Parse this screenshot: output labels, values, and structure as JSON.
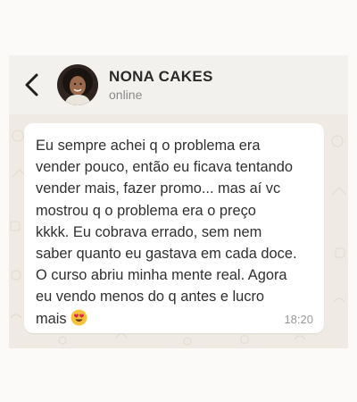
{
  "header": {
    "contact_name": "NONA CAKES",
    "status": "online",
    "back_icon": "chevron-left-icon"
  },
  "message": {
    "lines": [
      "Eu sempre achei q o problema era",
      "vender pouco, então eu ficava tentando",
      "vender mais, fazer promo... mas aí vc",
      "mostrou q o problema era o preço",
      "kkkk. Eu cobrava errado, sem nem",
      "saber quanto eu gastava em cada doce.",
      "O curso abriu minha mente real. Agora",
      "eu vendo menos do q antes e lucro",
      "mais"
    ],
    "emoji": "smiling-face-with-heart-eyes",
    "time": "18:20"
  },
  "colors": {
    "header_bg": "#f3f1ee",
    "chat_bg": "#efebe4",
    "bubble_bg": "#ffffff"
  }
}
